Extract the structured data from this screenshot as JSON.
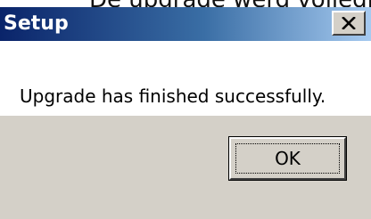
{
  "background_caption": "De upgrade werd volledig voltooid",
  "dialog": {
    "title": "Setup",
    "close_icon": "close-x-icon",
    "message": "Upgrade has finished successfully.",
    "ok_label": "OK"
  },
  "colors": {
    "titlebar_start": "#0a246a",
    "titlebar_end": "#a6caf0",
    "dialog_face": "#d4d0c8",
    "content_bg": "#ffffff"
  }
}
